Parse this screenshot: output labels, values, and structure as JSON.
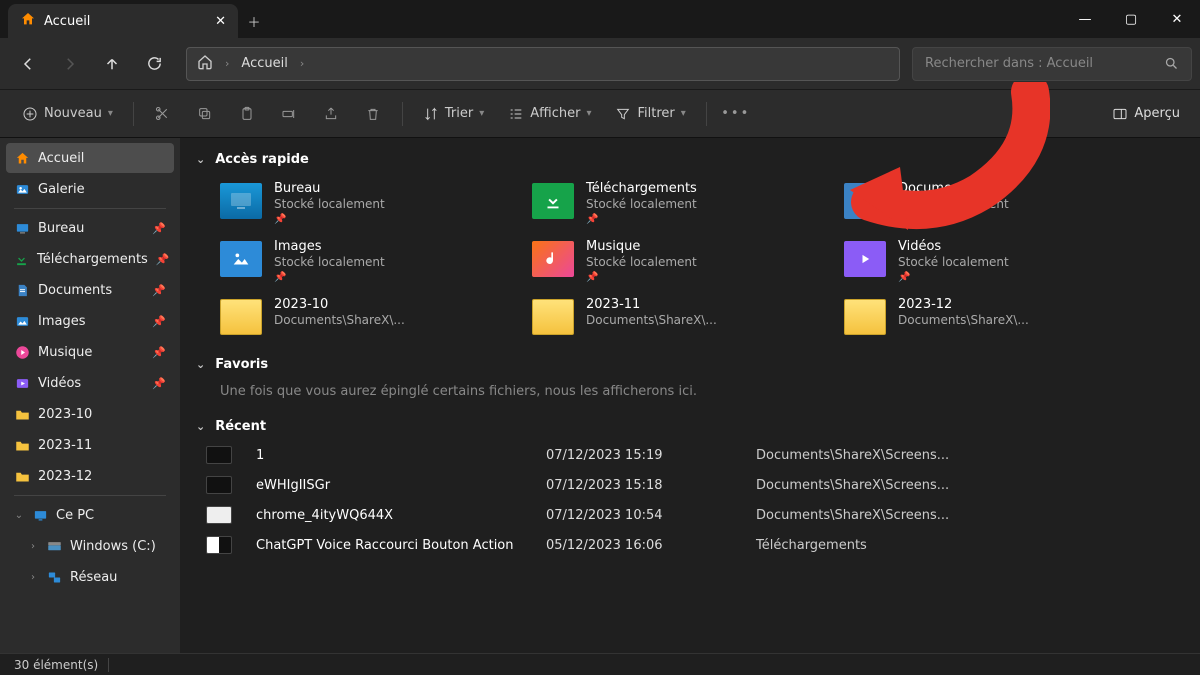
{
  "window": {
    "tab_title": "Accueil",
    "controls": {
      "min": "—",
      "max": "▢",
      "close": "✕"
    }
  },
  "nav": {
    "breadcrumb_root": "Accueil"
  },
  "search": {
    "placeholder": "Rechercher dans : Accueil"
  },
  "toolbar": {
    "new": "Nouveau",
    "sort": "Trier",
    "view": "Afficher",
    "filter": "Filtrer",
    "preview": "Aperçu"
  },
  "sidebar": {
    "home": "Accueil",
    "gallery": "Galerie",
    "pinned": [
      {
        "label": "Bureau",
        "icon": "desktop"
      },
      {
        "label": "Téléchargements",
        "icon": "download"
      },
      {
        "label": "Documents",
        "icon": "document"
      },
      {
        "label": "Images",
        "icon": "image"
      },
      {
        "label": "Musique",
        "icon": "music"
      },
      {
        "label": "Vidéos",
        "icon": "video"
      },
      {
        "label": "2023-10",
        "icon": "folder"
      },
      {
        "label": "2023-11",
        "icon": "folder"
      },
      {
        "label": "2023-12",
        "icon": "folder"
      }
    ],
    "pc": "Ce PC",
    "pc_children": [
      {
        "label": "Windows (C:)"
      },
      {
        "label": "Réseau"
      }
    ]
  },
  "sections": {
    "quick": "Accès rapide",
    "favs": "Favoris",
    "favs_hint": "Une fois que vous aurez épinglé certains fichiers, nous les afficherons ici.",
    "recent": "Récent"
  },
  "quick_access": [
    {
      "name": "Bureau",
      "sub": "Stocké localement",
      "icon": "desktop",
      "pinned": true
    },
    {
      "name": "Téléchargements",
      "sub": "Stocké localement",
      "icon": "download",
      "pinned": true
    },
    {
      "name": "Documents",
      "sub": "Stocké localement",
      "icon": "docs",
      "pinned": true
    },
    {
      "name": "Images",
      "sub": "Stocké localement",
      "icon": "images",
      "pinned": true
    },
    {
      "name": "Musique",
      "sub": "Stocké localement",
      "icon": "music",
      "pinned": true
    },
    {
      "name": "Vidéos",
      "sub": "Stocké localement",
      "icon": "videos",
      "pinned": true
    },
    {
      "name": "2023-10",
      "sub": "Documents\\ShareX\\...",
      "icon": "folder",
      "pinned": false
    },
    {
      "name": "2023-11",
      "sub": "Documents\\ShareX\\...",
      "icon": "folder",
      "pinned": false
    },
    {
      "name": "2023-12",
      "sub": "Documents\\ShareX\\...",
      "icon": "folder",
      "pinned": false
    }
  ],
  "recent": [
    {
      "name": "1",
      "date": "07/12/2023 15:19",
      "path": "Documents\\ShareX\\Screens...",
      "thumb": "dark"
    },
    {
      "name": "eWHIgIISGr",
      "date": "07/12/2023 15:18",
      "path": "Documents\\ShareX\\Screens...",
      "thumb": "dark"
    },
    {
      "name": "chrome_4ityWQ644X",
      "date": "07/12/2023 10:54",
      "path": "Documents\\ShareX\\Screens...",
      "thumb": "light"
    },
    {
      "name": "ChatGPT Voice Raccourci Bouton Action",
      "date": "05/12/2023 16:06",
      "path": "Téléchargements",
      "thumb": "split"
    }
  ],
  "status": {
    "count": "30 élément(s)"
  }
}
